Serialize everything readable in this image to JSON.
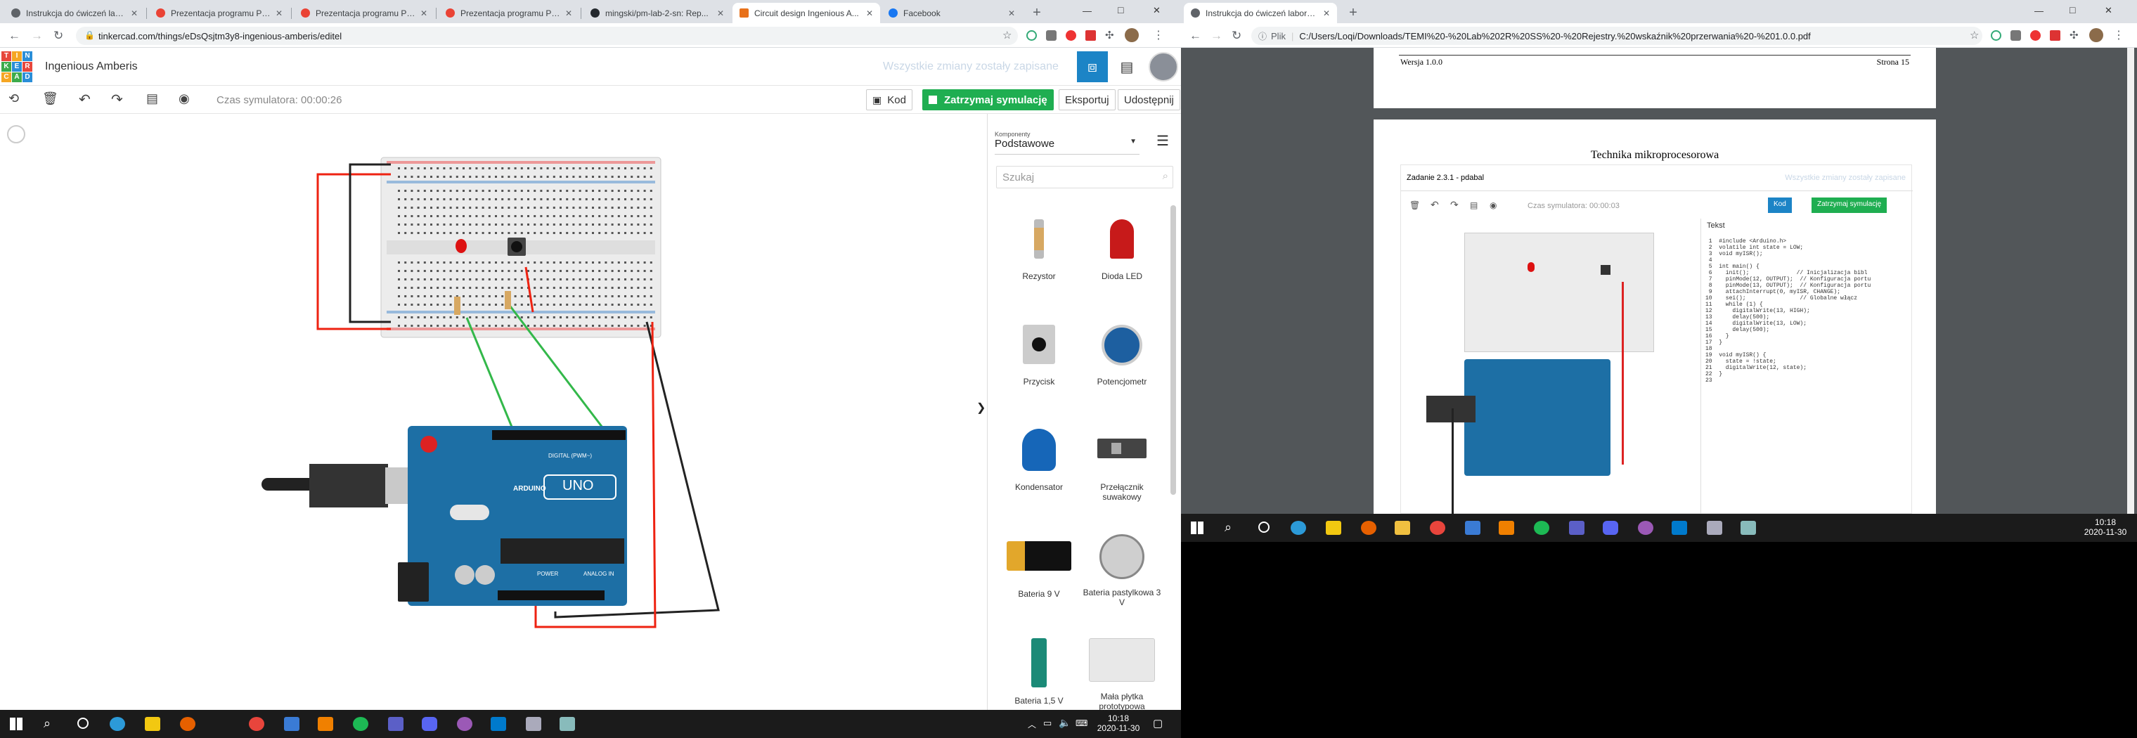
{
  "left_window": {
    "tabs": [
      {
        "title": "Instrukcja do ćwiczeń labo...",
        "color": "#5f6368"
      },
      {
        "title": "Prezentacja programu Pow...",
        "color": "#ea4335"
      },
      {
        "title": "Prezentacja programu Pow...",
        "color": "#ea4335"
      },
      {
        "title": "Prezentacja programu Pow...",
        "color": "#ea4335"
      },
      {
        "title": "mingski/pm-lab-2-sn: Rep...",
        "color": "#24292e"
      },
      {
        "title": "Circuit design Ingenious A...",
        "color": "#e8711a"
      },
      {
        "title": "Facebook",
        "color": "#1877f2"
      }
    ],
    "new_tab": "+",
    "url": "tinkercad.com/things/eDsQsjtm3y8-ingenious-amberis/editel",
    "window_controls": [
      "—",
      "□",
      "✕"
    ]
  },
  "tinkercad": {
    "logo_letters": [
      "T",
      "I",
      "N",
      "K",
      "E",
      "R",
      "C",
      "A",
      "D"
    ],
    "project_name": "Ingenious Amberis",
    "save_status": "Wszystkie zmiany zostały zapisane",
    "sim_time": "Czas symulatora: 00:00:26",
    "code_button": "Kod",
    "stop_sim_button": "Zatrzymaj symulację",
    "export_button": "Eksportuj",
    "share_button": "Udostępnij",
    "components_label": "Komponenty",
    "components_category": "Podstawowe",
    "search_placeholder": "Szukaj",
    "collapse_arrow": "❯",
    "components": [
      {
        "name": "Rezystor",
        "icon": "resistor-icon"
      },
      {
        "name": "Dioda LED",
        "icon": "led-icon"
      },
      {
        "name": "Przycisk",
        "icon": "pushbutton-icon"
      },
      {
        "name": "Potencjometr",
        "icon": "potentiometer-icon"
      },
      {
        "name": "Kondensator",
        "icon": "capacitor-icon"
      },
      {
        "name": "Przełącznik suwakowy",
        "icon": "slide-switch-icon"
      },
      {
        "name": "Bateria 9 V",
        "icon": "battery-9v-icon"
      },
      {
        "name": "Bateria pastylkowa 3 V",
        "icon": "coin-battery-icon"
      },
      {
        "name": "Bateria 1,5 V",
        "icon": "battery-aa-icon"
      },
      {
        "name": "Mała płytka prototypowa",
        "icon": "breadboard-small-icon"
      }
    ],
    "arduino_labels": {
      "brand": "ARDUINO",
      "model": "UNO",
      "digital": "DIGITAL (PWM~)",
      "power": "POWER",
      "analog": "ANALOG IN"
    }
  },
  "right_window": {
    "tab_title": "Instrukcja do ćwiczeń laboratory",
    "new_tab": "+",
    "url_prefix": "Plik",
    "url": "C:/Users/Loqi/Downloads/TEMI%20-%20Lab%202R%20SS%20-%20Rejestry.%20wskaźnik%20przerwania%20-%201.0.0.pdf",
    "window_controls": [
      "—",
      "□",
      "✕"
    ]
  },
  "pdf": {
    "prev_footer_left": "Wersja 1.0.0",
    "prev_footer_right": "Strona 15",
    "page_header": "Technika mikroprocesorowa",
    "screenshot": {
      "title": "Zadanie 2.3.1 - pdabal",
      "save_status": "Wszystkie zmiany zostały zapisane",
      "sim_time": "Czas symulatora: 00:00:03",
      "code_button": "Kod",
      "stop_button": "Zatrzymaj symulację",
      "panel_label": "Tekst",
      "code_lines": [
        "#include <Arduino.h>",
        "volatile int state = LOW;",
        "void myISR();",
        "",
        "int main() {",
        "  init();              // Inicjalizacja bibl",
        "  pinMode(12, OUTPUT);  // Konfiguracja portu",
        "  pinMode(13, OUTPUT);  // Konfiguracja portu",
        "  attachInterrupt(0, myISR, CHANGE);",
        "  sei();                // Globalne włącz",
        "  while (1) {",
        "    digitalWrite(13, HIGH);",
        "    delay(500);",
        "    digitalWrite(13, LOW);",
        "    delay(500);",
        "  }",
        "}",
        "",
        "void myISR() {",
        "  state = !state;",
        "  digitalWrite(12, state);",
        "}",
        ""
      ]
    }
  },
  "taskbar_left": {
    "time": "10:18",
    "date": "2020-11-30"
  },
  "taskbar_right": {
    "time": "10:18",
    "date": "2020-11-30"
  },
  "colors": {
    "accent_green": "#1fae51",
    "accent_blue": "#1c84c6",
    "arduino_blue": "#1d6fa5"
  }
}
